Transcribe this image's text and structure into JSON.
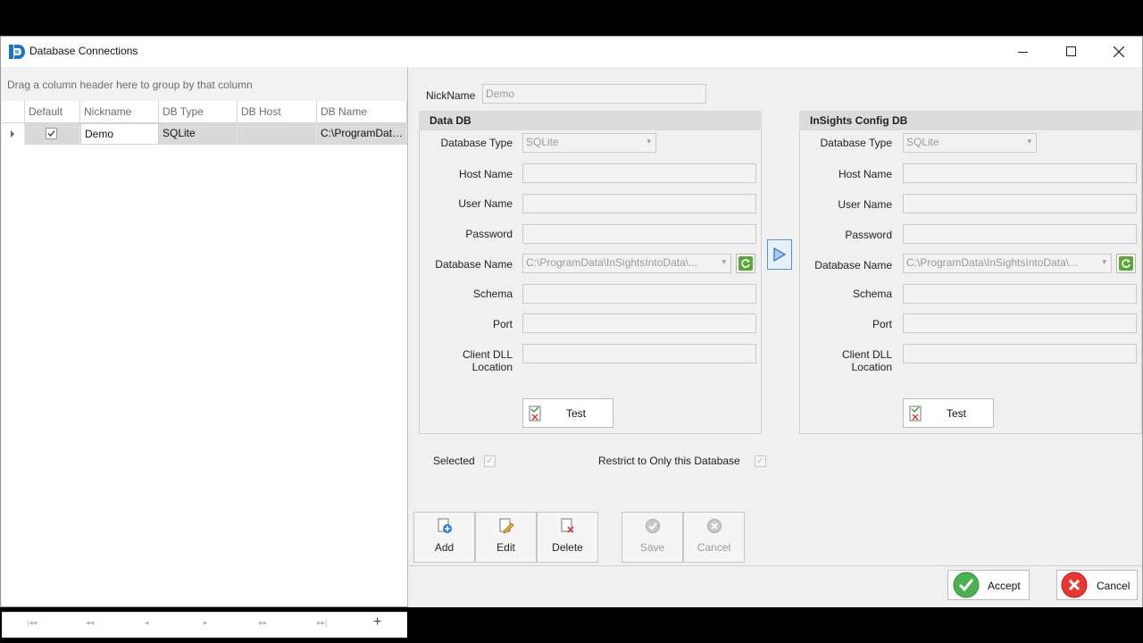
{
  "window": {
    "title": "Database Connections"
  },
  "grid": {
    "group_hint": "Drag a column header here to group by that column",
    "columns": [
      "Default",
      "Nickname",
      "DB Type",
      "DB Host",
      "DB Name"
    ],
    "rows": [
      {
        "default": true,
        "nickname": "Demo",
        "db_type": "SQLite",
        "db_host": "",
        "db_name": "C:\\ProgramData\\InSightsIntoData\\..."
      }
    ],
    "nav_add": "+"
  },
  "nickname": {
    "label": "NickName",
    "value": "Demo"
  },
  "data_db": {
    "header": "Data DB",
    "labels": {
      "db_type": "Database Type",
      "host": "Host Name",
      "user": "User Name",
      "password": "Password",
      "db_name": "Database Name",
      "schema": "Schema",
      "port": "Port",
      "dll": "Client DLL Location"
    },
    "db_type": "SQLite",
    "db_name": "C:\\ProgramData\\InSightsIntoData\\...",
    "test_label": "Test"
  },
  "config_db": {
    "header": "InSights Config DB",
    "labels": {
      "db_type": "Database Type",
      "host": "Host Name",
      "user": "User Name",
      "password": "Password",
      "db_name": "Database Name",
      "schema": "Schema",
      "port": "Port",
      "dll": "Client DLL Location"
    },
    "db_type": "SQLite",
    "db_name": "C:\\ProgramData\\InSightsIntoData\\...",
    "test_label": "Test"
  },
  "options": {
    "selected_label": "Selected",
    "restrict_label": "Restrict to Only this Database"
  },
  "toolbar": {
    "add": "Add",
    "edit": "Edit",
    "delete": "Delete",
    "save": "Save",
    "cancel": "Cancel"
  },
  "footer": {
    "accept": "Accept",
    "cancel": "Cancel"
  },
  "colors": {
    "accent_blue": "#1e73be",
    "accept_green": "#4caf50",
    "cancel_red": "#e53935",
    "selected_row": "#d9d9d9"
  }
}
